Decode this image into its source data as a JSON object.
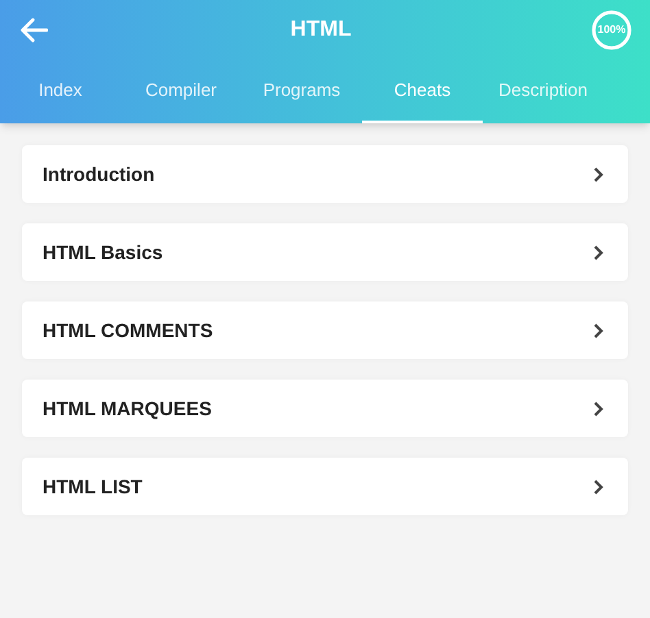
{
  "header": {
    "title": "HTML",
    "progress": {
      "reading": "100%",
      "level": 1
    }
  },
  "tabs": [
    {
      "label": "Index",
      "selected": false
    },
    {
      "label": "Compiler",
      "selected": false
    },
    {
      "label": "Programs",
      "selected": false
    },
    {
      "label": "Cheats",
      "selected": true
    },
    {
      "label": "Description",
      "selected": false
    }
  ],
  "items": [
    {
      "label": "Introduction"
    },
    {
      "label": "HTML Basics"
    },
    {
      "label": "HTML COMMENTS"
    },
    {
      "label": "HTML MARQUEES"
    },
    {
      "label": "HTML LIST"
    }
  ]
}
